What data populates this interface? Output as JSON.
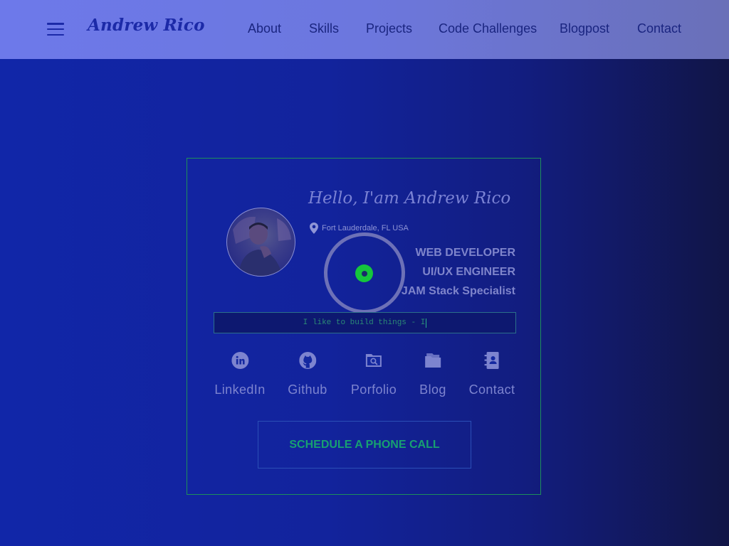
{
  "header": {
    "brand": "Andrew Rico",
    "nav": [
      "About",
      "Skills",
      "Projects",
      "Code Challenges",
      "Blogpost",
      "Contact"
    ]
  },
  "profile": {
    "greeting": "Hello, I'am Andrew Rico",
    "location": "Fort Lauderdale, FL USA",
    "roles": [
      "WEB DEVELOPER",
      "UI/UX ENGINEER",
      "JAM Stack Specialist"
    ],
    "typing_text": "I like to build things - I"
  },
  "social_links": [
    {
      "label": "LinkedIn",
      "icon": "linkedin-icon"
    },
    {
      "label": "Github",
      "icon": "github-icon"
    },
    {
      "label": "Porfolio",
      "icon": "portfolio-icon"
    },
    {
      "label": "Blog",
      "icon": "folder-icon"
    },
    {
      "label": "Contact",
      "icon": "contact-book-icon"
    }
  ],
  "cta": {
    "label": "SCHEDULE A PHONE CALL"
  },
  "colors": {
    "navbar": "#6d79ea",
    "background": "#1126a8",
    "accent_green": "#15c63c",
    "card_border": "#1e8f5a",
    "cta_text": "#17a071"
  }
}
